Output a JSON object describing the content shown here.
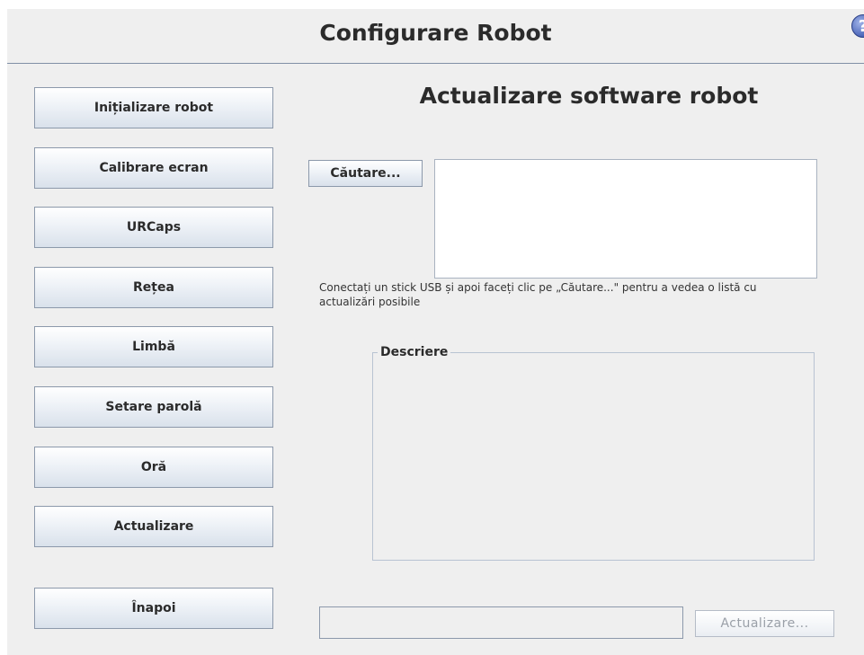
{
  "header": {
    "title": "Configurare Robot",
    "help_icon": "question-circle-icon",
    "help_glyph": "?"
  },
  "sidebar": {
    "items": [
      {
        "label": "Inițializare robot"
      },
      {
        "label": "Calibrare ecran"
      },
      {
        "label": "URCaps"
      },
      {
        "label": "Rețea"
      },
      {
        "label": "Limbă"
      },
      {
        "label": "Setare parolă"
      },
      {
        "label": "Oră"
      },
      {
        "label": "Actualizare"
      }
    ],
    "back_label": "Înapoi"
  },
  "main": {
    "title": "Actualizare software robot",
    "search_button": "Căutare...",
    "hint_line1": "Conectați un stick USB și apoi faceți clic pe „Căutare...\" pentru a vedea o listă cu",
    "hint_line2": "actualizări posibile",
    "description_legend": "Descriere",
    "file_path_value": "",
    "update_button": "Actualizare...",
    "update_button_enabled": false
  },
  "colors": {
    "background": "#efefef",
    "button_border": "#8c99ab",
    "help_icon": "#4a64b8",
    "disabled_text": "#9aa0a8"
  }
}
